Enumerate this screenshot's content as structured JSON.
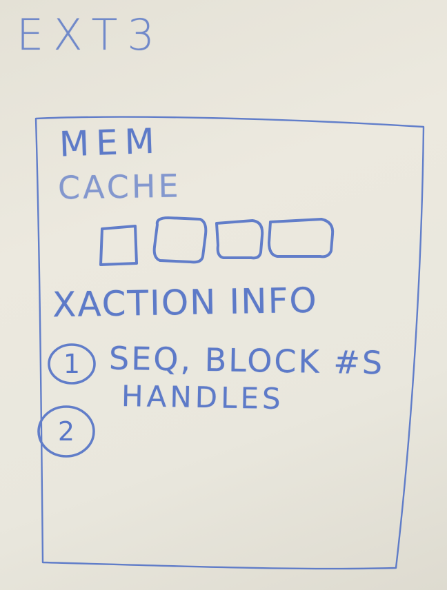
{
  "title": "EXT3",
  "frame": {
    "heading": "MEM",
    "cache_label": "CACHE",
    "cache_blocks": 4,
    "section_label": "XACTION INFO",
    "items": [
      {
        "number": "1",
        "text": "SEQ, BLOCK #S",
        "continuation": "HANDLES"
      },
      {
        "number": "2",
        "text": ""
      }
    ]
  },
  "colors": {
    "ink": "#3f63c4",
    "board": "#e9e7dd"
  }
}
